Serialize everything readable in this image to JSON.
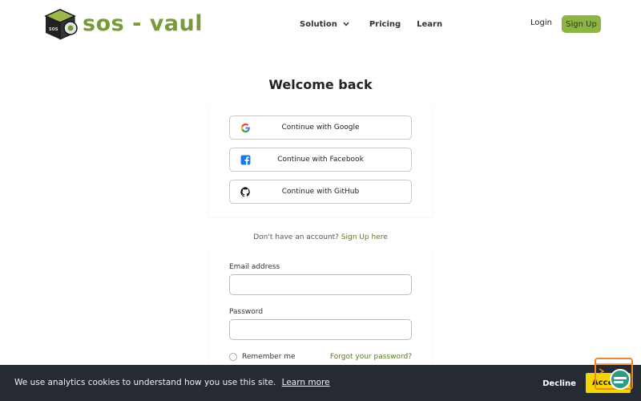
{
  "header": {
    "brand": "sos - vaul",
    "nav": {
      "solution": "Solution",
      "pricing": "Pricing",
      "learn": "Learn"
    },
    "login": "Login",
    "signup": "Sign Up"
  },
  "main": {
    "title": "Welcome back",
    "social": {
      "google": "Continue with Google",
      "facebook": "Continue with Facebook",
      "github": "Continue with GitHub"
    },
    "signup_prompt": {
      "text": "Don't have an account?",
      "link": "Sign Up here"
    },
    "form": {
      "email_label": "Email address",
      "email_value": "",
      "password_label": "Password",
      "password_value": "",
      "remember": "Remember me",
      "forgot": "Forgot your password?"
    }
  },
  "cookie": {
    "text": "We use analytics cookies to understand how you use this site.",
    "learn_more": "Learn more",
    "decline": "Decline",
    "accept": "Accept"
  },
  "colors": {
    "brand": "#7a9a3a",
    "signup_button": "#8cb543",
    "link": "#5a7a1e",
    "cookie_bg": "#262b33",
    "accept_button": "#f1d600"
  },
  "icons": [
    "logo-icon",
    "chevron-down-icon",
    "google-icon",
    "facebook-icon",
    "github-icon",
    "chat-widget-icon"
  ]
}
